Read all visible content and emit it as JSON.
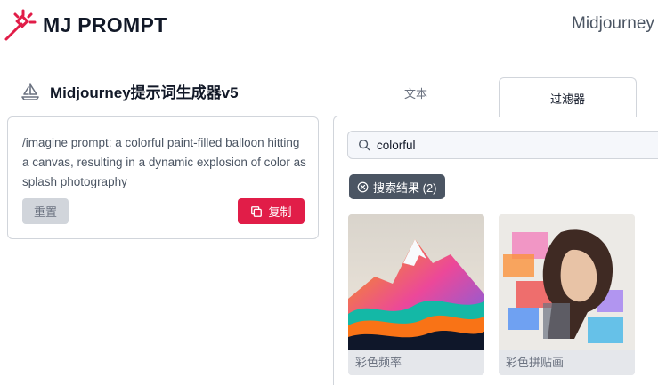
{
  "header": {
    "logo_text": "MJ PROMPT",
    "right_text": "Midjourney"
  },
  "generator": {
    "title": "Midjourney提示词生成器v5",
    "prompt": "/imagine prompt: a colorful paint-filled balloon hitting a canvas, resulting in a dynamic explosion of color as splash photography",
    "reset_label": "重置",
    "copy_label": "复制"
  },
  "tabs": [
    {
      "label": "文本"
    },
    {
      "label": "过滤器"
    }
  ],
  "filter": {
    "search_value": "colorful",
    "result_chip": "搜索结果 (2)",
    "results": [
      {
        "caption": "彩色频率"
      },
      {
        "caption": "彩色拼贴画"
      }
    ]
  },
  "colors": {
    "accent": "#e11d48",
    "chip": "#4b5563",
    "border": "#d1d5db"
  }
}
